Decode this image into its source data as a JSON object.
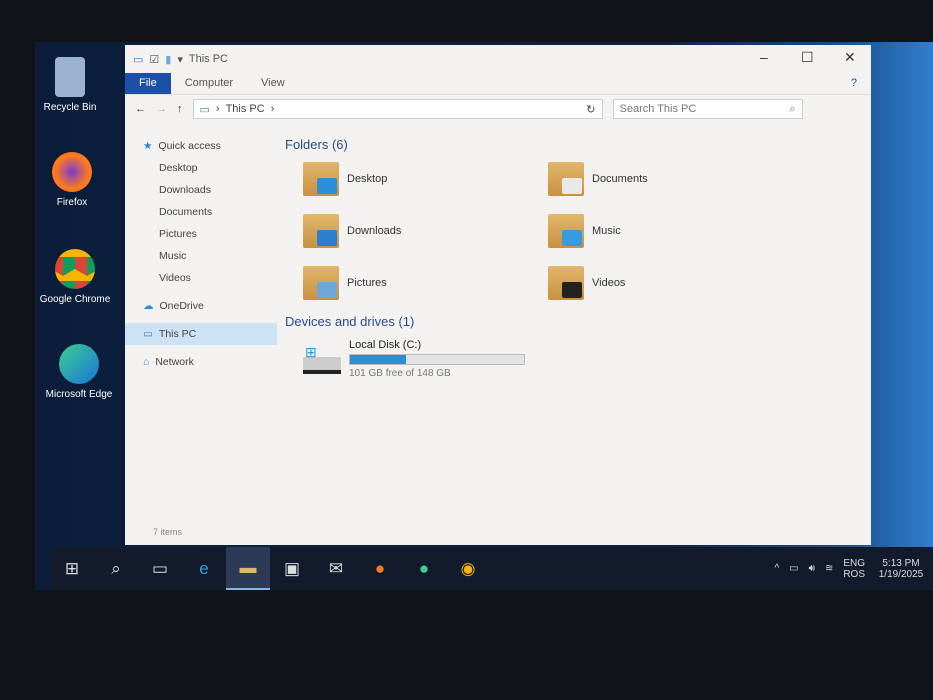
{
  "desktop": {
    "icons": [
      {
        "label": "Recycle Bin"
      },
      {
        "label": "Firefox"
      },
      {
        "label": "Google Chrome"
      },
      {
        "label": "Microsoft Edge"
      }
    ]
  },
  "window": {
    "title": "This PC",
    "ribbon_tabs": [
      "File",
      "Computer",
      "View"
    ],
    "address": {
      "crumbs": [
        "This PC"
      ],
      "search_placeholder": "Search This PC"
    },
    "nav": [
      {
        "label": "Quick access"
      },
      {
        "label": "Desktop"
      },
      {
        "label": "Downloads"
      },
      {
        "label": "Documents"
      },
      {
        "label": "Pictures"
      },
      {
        "label": "Music"
      },
      {
        "label": "Videos"
      },
      {
        "label": "OneDrive"
      },
      {
        "label": "This PC"
      },
      {
        "label": "Network"
      }
    ],
    "folders_header": "Folders (6)",
    "folders": [
      {
        "name": "Desktop",
        "color": "#2a8fd6"
      },
      {
        "name": "Documents",
        "color": "#e8e8e8"
      },
      {
        "name": "Downloads",
        "color": "#2a7fd0"
      },
      {
        "name": "Music",
        "color": "#3a9ae0"
      },
      {
        "name": "Pictures",
        "color": "#6fa8d8"
      },
      {
        "name": "Videos",
        "color": "#222222"
      }
    ],
    "drives_header": "Devices and drives (1)",
    "drive": {
      "name": "Local Disk (C:)",
      "space": "101 GB free of 148 GB",
      "used_fraction": 0.32
    },
    "status": "7 items"
  },
  "taskbar": {
    "lang1": "ENG",
    "lang2": "ROS",
    "time": "5:13 PM",
    "date": "1/19/2025"
  }
}
